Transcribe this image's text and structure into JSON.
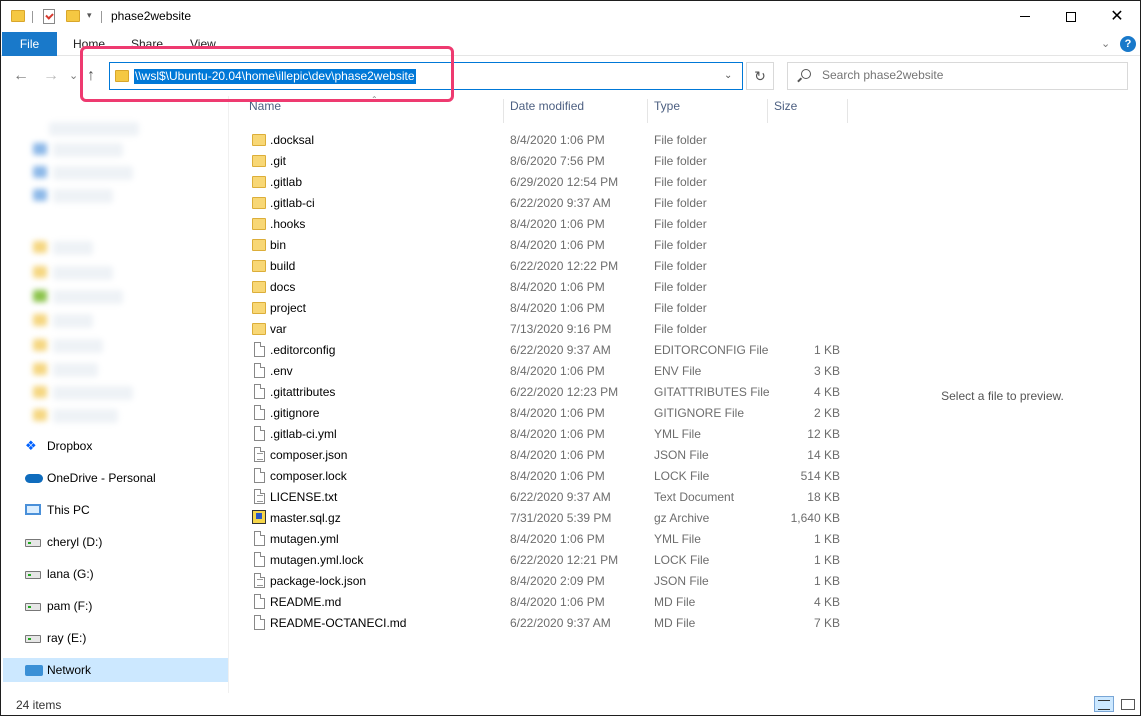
{
  "window": {
    "title": "phase2website"
  },
  "ribbon": {
    "file": "File",
    "home": "Home",
    "share": "Share",
    "view": "View",
    "help": "?"
  },
  "nav": {
    "back": "←",
    "forward": "→",
    "recent": "⌄",
    "up": "↑",
    "address": "\\\\wsl$\\Ubuntu-20.04\\home\\illepic\\dev\\phase2website",
    "refresh": "↻",
    "search_placeholder": "Search phase2website"
  },
  "sidebar": {
    "items": [
      {
        "label": "Dropbox",
        "icon": "dropbox-icon"
      },
      {
        "label": "OneDrive - Personal",
        "icon": "onedrive-icon"
      },
      {
        "label": "This PC",
        "icon": "this-pc-icon"
      },
      {
        "label": "cheryl (D:)",
        "icon": "drive-icon"
      },
      {
        "label": "lana (G:)",
        "icon": "drive-icon"
      },
      {
        "label": "pam (F:)",
        "icon": "drive-icon"
      },
      {
        "label": "ray (E:)",
        "icon": "drive-icon"
      },
      {
        "label": "Network",
        "icon": "network-icon",
        "selected": true
      }
    ]
  },
  "columns": {
    "name": "Name",
    "date": "Date modified",
    "type": "Type",
    "size": "Size"
  },
  "files": [
    {
      "name": ".docksal",
      "date": "8/4/2020 1:06 PM",
      "type": "File folder",
      "size": "",
      "icon": "folder"
    },
    {
      "name": ".git",
      "date": "8/6/2020 7:56 PM",
      "type": "File folder",
      "size": "",
      "icon": "folder"
    },
    {
      "name": ".gitlab",
      "date": "6/29/2020 12:54 PM",
      "type": "File folder",
      "size": "",
      "icon": "folder"
    },
    {
      "name": ".gitlab-ci",
      "date": "6/22/2020 9:37 AM",
      "type": "File folder",
      "size": "",
      "icon": "folder"
    },
    {
      "name": ".hooks",
      "date": "8/4/2020 1:06 PM",
      "type": "File folder",
      "size": "",
      "icon": "folder"
    },
    {
      "name": "bin",
      "date": "8/4/2020 1:06 PM",
      "type": "File folder",
      "size": "",
      "icon": "folder"
    },
    {
      "name": "build",
      "date": "6/22/2020 12:22 PM",
      "type": "File folder",
      "size": "",
      "icon": "folder"
    },
    {
      "name": "docs",
      "date": "8/4/2020 1:06 PM",
      "type": "File folder",
      "size": "",
      "icon": "folder"
    },
    {
      "name": "project",
      "date": "8/4/2020 1:06 PM",
      "type": "File folder",
      "size": "",
      "icon": "folder"
    },
    {
      "name": "var",
      "date": "7/13/2020 9:16 PM",
      "type": "File folder",
      "size": "",
      "icon": "folder"
    },
    {
      "name": ".editorconfig",
      "date": "6/22/2020 9:37 AM",
      "type": "EDITORCONFIG File",
      "size": "1 KB",
      "icon": "file"
    },
    {
      "name": ".env",
      "date": "8/4/2020 1:06 PM",
      "type": "ENV File",
      "size": "3 KB",
      "icon": "file"
    },
    {
      "name": ".gitattributes",
      "date": "6/22/2020 12:23 PM",
      "type": "GITATTRIBUTES File",
      "size": "4 KB",
      "icon": "file"
    },
    {
      "name": ".gitignore",
      "date": "8/4/2020 1:06 PM",
      "type": "GITIGNORE File",
      "size": "2 KB",
      "icon": "file"
    },
    {
      "name": ".gitlab-ci.yml",
      "date": "8/4/2020 1:06 PM",
      "type": "YML File",
      "size": "12 KB",
      "icon": "file"
    },
    {
      "name": "composer.json",
      "date": "8/4/2020 1:06 PM",
      "type": "JSON File",
      "size": "14 KB",
      "icon": "text"
    },
    {
      "name": "composer.lock",
      "date": "8/4/2020 1:06 PM",
      "type": "LOCK File",
      "size": "514 KB",
      "icon": "file"
    },
    {
      "name": "LICENSE.txt",
      "date": "6/22/2020 9:37 AM",
      "type": "Text Document",
      "size": "18 KB",
      "icon": "text"
    },
    {
      "name": "master.sql.gz",
      "date": "7/31/2020 5:39 PM",
      "type": "gz Archive",
      "size": "1,640 KB",
      "icon": "archive"
    },
    {
      "name": "mutagen.yml",
      "date": "8/4/2020 1:06 PM",
      "type": "YML File",
      "size": "1 KB",
      "icon": "file"
    },
    {
      "name": "mutagen.yml.lock",
      "date": "6/22/2020 12:21 PM",
      "type": "LOCK File",
      "size": "1 KB",
      "icon": "file"
    },
    {
      "name": "package-lock.json",
      "date": "8/4/2020 2:09 PM",
      "type": "JSON File",
      "size": "1 KB",
      "icon": "text"
    },
    {
      "name": "README.md",
      "date": "8/4/2020 1:06 PM",
      "type": "MD File",
      "size": "4 KB",
      "icon": "file"
    },
    {
      "name": "README-OCTANECI.md",
      "date": "6/22/2020 9:37 AM",
      "type": "MD File",
      "size": "7 KB",
      "icon": "file"
    }
  ],
  "preview": {
    "text": "Select a file to preview."
  },
  "status": {
    "count": "24 items"
  },
  "colors": {
    "accent": "#0078d7",
    "file_tab": "#1979ca",
    "highlight_box": "#ee3a70",
    "selected_nav": "#cce8ff"
  }
}
